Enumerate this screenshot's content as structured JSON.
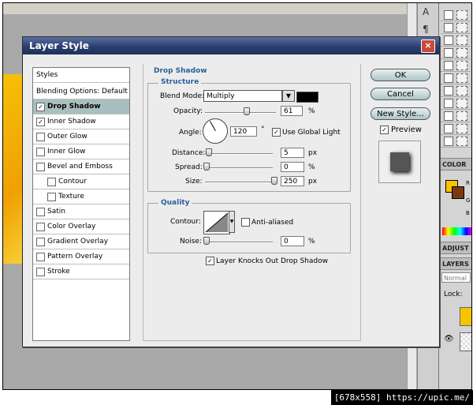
{
  "window": {
    "title": "Layer Style",
    "close_glyph": "×"
  },
  "styles_header": "Styles",
  "styles": [
    {
      "label": "Blending Options: Default",
      "checkbox": false,
      "checked": false,
      "indent": 0,
      "selected": false
    },
    {
      "label": "Drop Shadow",
      "checkbox": true,
      "checked": true,
      "indent": 0,
      "selected": true
    },
    {
      "label": "Inner Shadow",
      "checkbox": true,
      "checked": true,
      "indent": 0,
      "selected": false
    },
    {
      "label": "Outer Glow",
      "checkbox": true,
      "checked": false,
      "indent": 0,
      "selected": false
    },
    {
      "label": "Inner Glow",
      "checkbox": true,
      "checked": false,
      "indent": 0,
      "selected": false
    },
    {
      "label": "Bevel and Emboss",
      "checkbox": true,
      "checked": false,
      "indent": 0,
      "selected": false
    },
    {
      "label": "Contour",
      "checkbox": true,
      "checked": false,
      "indent": 1,
      "selected": false
    },
    {
      "label": "Texture",
      "checkbox": true,
      "checked": false,
      "indent": 1,
      "selected": false
    },
    {
      "label": "Satin",
      "checkbox": true,
      "checked": false,
      "indent": 0,
      "selected": false
    },
    {
      "label": "Color Overlay",
      "checkbox": true,
      "checked": false,
      "indent": 0,
      "selected": false
    },
    {
      "label": "Gradient Overlay",
      "checkbox": true,
      "checked": false,
      "indent": 0,
      "selected": false
    },
    {
      "label": "Pattern Overlay",
      "checkbox": true,
      "checked": false,
      "indent": 0,
      "selected": false
    },
    {
      "label": "Stroke",
      "checkbox": true,
      "checked": false,
      "indent": 0,
      "selected": false
    }
  ],
  "drop_shadow": {
    "section_title": "Drop Shadow",
    "structure_title": "Structure",
    "blend_mode_label": "Blend Mode:",
    "blend_mode_value": "Multiply",
    "shadow_color": "#000000",
    "opacity_label": "Opacity:",
    "opacity_value": "61",
    "opacity_unit": "%",
    "opacity_level": 61,
    "angle_label": "Angle:",
    "angle_value": "120",
    "angle_unit": "°",
    "use_global_light_label": "Use Global Light",
    "use_global_light": true,
    "distance_label": "Distance:",
    "distance_value": "5",
    "distance_unit": "px",
    "spread_label": "Spread:",
    "spread_value": "0",
    "spread_unit": "%",
    "size_label": "Size:",
    "size_value": "250",
    "size_unit": "px",
    "quality_title": "Quality",
    "contour_label": "Contour:",
    "anti_aliased_label": "Anti-aliased",
    "anti_aliased": false,
    "noise_label": "Noise:",
    "noise_value": "0",
    "noise_unit": "%",
    "knockout_label": "Layer Knocks Out Drop Shadow",
    "knockout": true
  },
  "buttons": {
    "ok": "OK",
    "cancel": "Cancel",
    "new_style": "New Style..."
  },
  "preview": {
    "label": "Preview",
    "checked": true
  },
  "background_app": {
    "tool_glyphs": [
      "A",
      "¶"
    ],
    "color_tab": "COLOR",
    "color_channels": [
      "R",
      "G",
      "B"
    ],
    "adjust_tab": "ADJUST",
    "layers_tab": "LAYERS",
    "blend_mode": "Normal",
    "lock_label": "Lock:",
    "fg_color": "#f7c400",
    "bg_color": "#7a3a10"
  },
  "status_text": "[678x558] https://upic.me/"
}
